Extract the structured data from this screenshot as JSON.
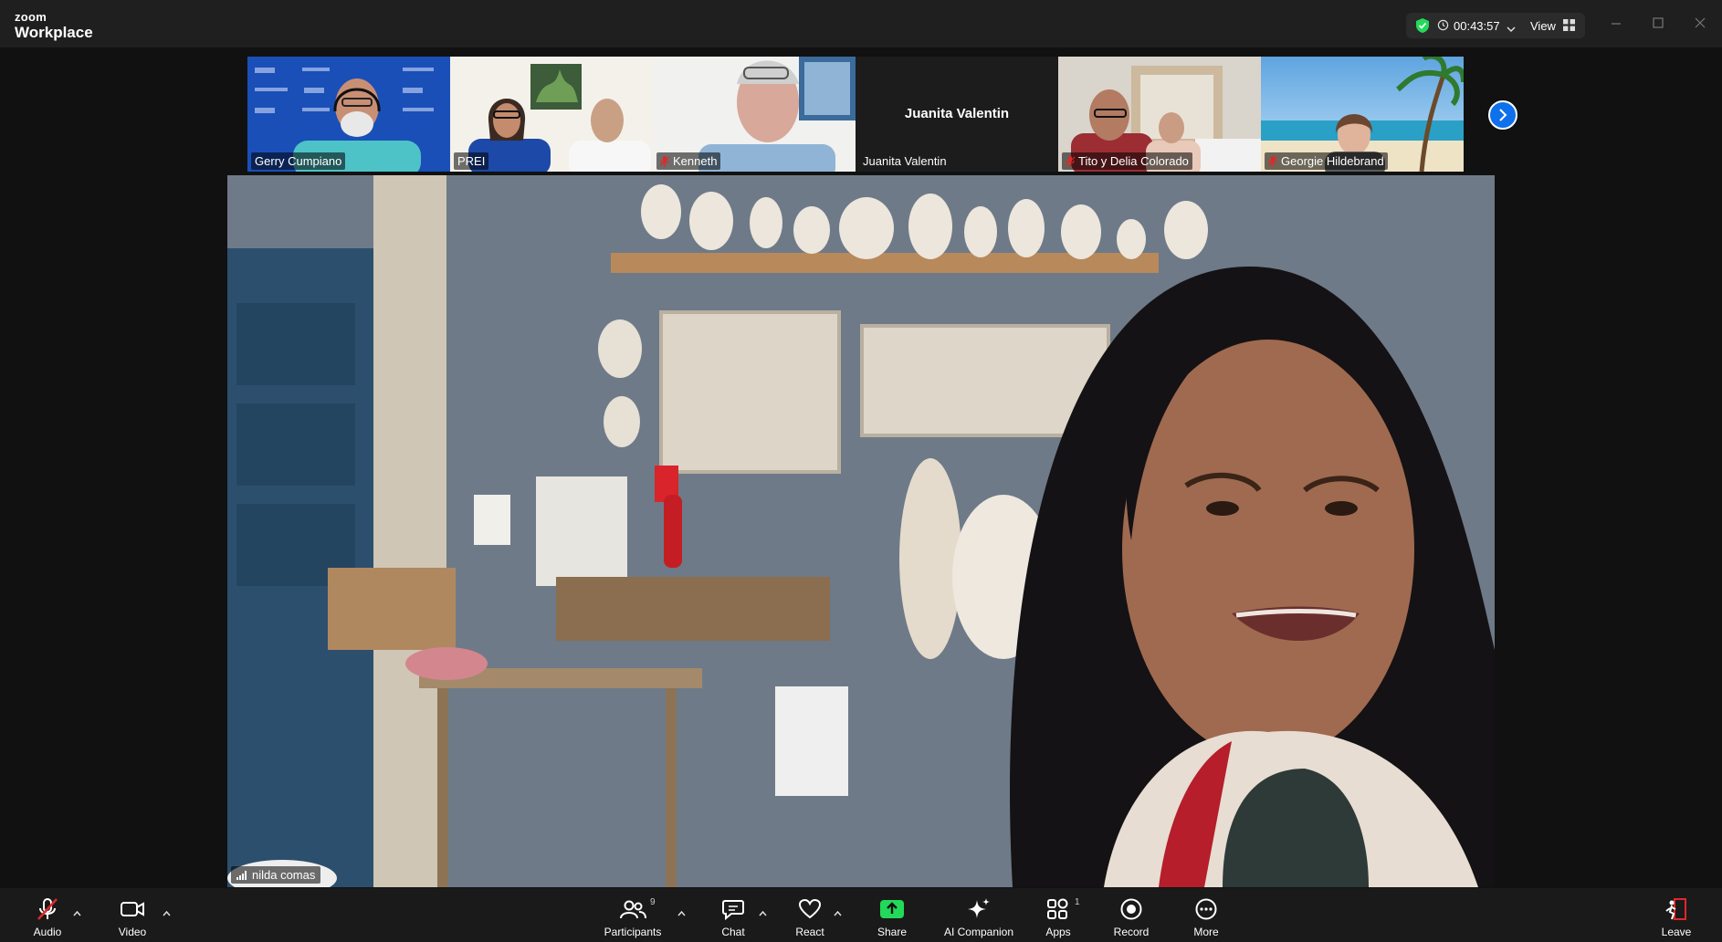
{
  "app": {
    "brand_top": "zoom",
    "brand_bottom": "Workplace"
  },
  "meeting": {
    "timer": "00:43:57",
    "view_label": "View",
    "security_color": "#23d959"
  },
  "participants_strip": [
    {
      "name": "Gerry Cumpiano",
      "muted": false
    },
    {
      "name": "PREI",
      "muted": false
    },
    {
      "name": "Kenneth",
      "muted": true
    },
    {
      "name": "Juanita Valentin",
      "muted": false,
      "video_off": true
    },
    {
      "name": "Tito y Delia Colorado",
      "muted": true
    },
    {
      "name": "Georgie Hildebrand",
      "muted": true
    }
  ],
  "active_speaker": {
    "name": "nilda comas"
  },
  "toolbar": {
    "audio": "Audio",
    "video": "Video",
    "participants": "Participants",
    "participants_count": "9",
    "chat": "Chat",
    "react": "React",
    "share": "Share",
    "ai_companion": "AI Companion",
    "apps": "Apps",
    "apps_count": "1",
    "record": "Record",
    "more": "More",
    "leave": "Leave"
  },
  "colors": {
    "accent_blue": "#0e71eb",
    "share_green": "#23d959",
    "muted_red": "#e02828"
  }
}
